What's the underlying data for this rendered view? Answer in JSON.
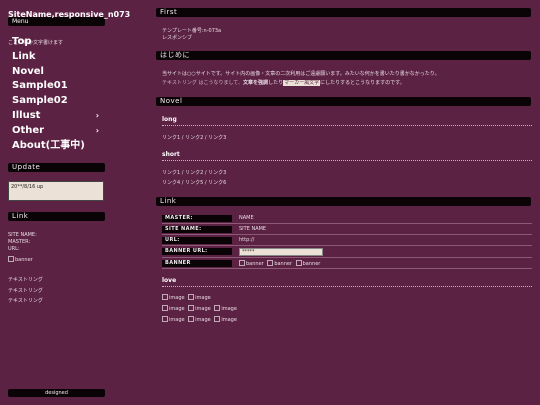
{
  "site": {
    "title": "SiteName,responsive_n073",
    "menu_label": "Menu",
    "tagline": "ここに何か文字書けます"
  },
  "nav": {
    "top": "Top",
    "link": "Link",
    "novel": "Novel",
    "sample01": "Sample01",
    "sample02": "Sample02",
    "illust": "Illust",
    "other": "Other",
    "about": "About(工事中)",
    "chevron": "›"
  },
  "sidebar": {
    "update_title": "Update",
    "update_text": "20**/8/16 up",
    "link_title": "Link",
    "site_name_label": "SITE NAME:",
    "master_label": "MASTER:",
    "url_label": "URL:",
    "banner_alt": "banner",
    "text_links": [
      "テキストリング",
      "テキストリング",
      "テキストリング"
    ],
    "footer": "designed"
  },
  "first": {
    "title": "First",
    "line1": "テンプレート番号:n-073a",
    "line2": "レスポンシブ"
  },
  "hajimeni": {
    "title": "はじめに",
    "line1": "当サイトは○○サイトです。サイト内の画像・文章の二次利用はご遠慮願います。みたいな何かを書いたり書かなかったり。",
    "line2_pre": "テキストリング はこうなりまして、",
    "line2_bold": "文章を強調",
    "line2_mid": "したり",
    "line2_marked": "マーカー風文字",
    "line2_post": "にしたりするとこうなりますのです。"
  },
  "novel": {
    "title": "Novel",
    "long_title": "long",
    "long_links": [
      "リンク1",
      "リンク2",
      "リンク3"
    ],
    "short_title": "short",
    "short_links_1": [
      "リンク1",
      "リンク2",
      "リンク3"
    ],
    "short_links_2": [
      "リンク4",
      "リンク5",
      "リンク6"
    ],
    "separator": "/"
  },
  "link": {
    "title": "Link",
    "master_key": "MASTER:",
    "master_val": "NAME",
    "sitename_key": "SITE NAME:",
    "sitename_val": "SITE NAME",
    "url_key": "URL:",
    "url_val": "http://",
    "banner_url_key": "BANNER URL:",
    "banner_url_val": "*****",
    "banner_key": "BANNER",
    "banner_alts": [
      "banner",
      "banner",
      "banner"
    ]
  },
  "love": {
    "title": "love",
    "image_alt": "image"
  }
}
